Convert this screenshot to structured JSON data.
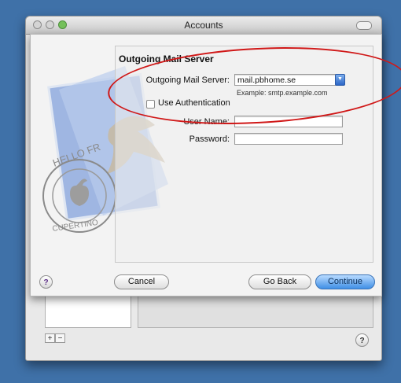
{
  "window": {
    "title": "Accounts"
  },
  "sheet": {
    "section_title": "Outgoing Mail Server",
    "smtp_label": "Outgoing Mail Server:",
    "smtp_value": "mail.pbhome.se",
    "example": "Example: smtp.example.com",
    "use_auth_label": "Use Authentication",
    "use_auth_checked": false,
    "username_label": "User Name:",
    "username_value": "",
    "password_label": "Password:",
    "password_value": "",
    "stamp_text_top": "HELLO FR",
    "stamp_text_bottom": "CUPERTINO",
    "help_glyph": "?",
    "cancel_label": "Cancel",
    "goback_label": "Go Back",
    "continue_label": "Continue"
  },
  "bottom": {
    "add_glyph": "+",
    "remove_glyph": "−",
    "help_glyph": "?"
  },
  "colors": {
    "desktop": "#3f71a8",
    "highlight": "#d01818",
    "default_button": "#3f8fe6"
  }
}
